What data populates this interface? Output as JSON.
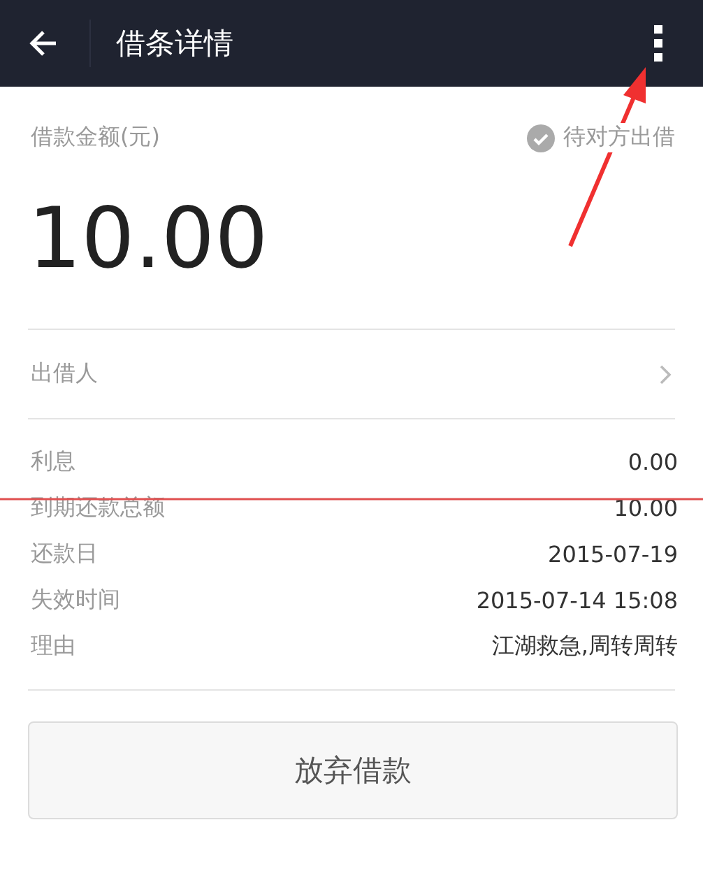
{
  "header": {
    "title": "借条详情"
  },
  "amount": {
    "label": "借款金额(元)",
    "value": "10.00",
    "status": "待对方出借"
  },
  "lender": {
    "label": "出借人"
  },
  "details": [
    {
      "label": "利息",
      "value": "0.00"
    },
    {
      "label": "到期还款总额",
      "value": "10.00"
    },
    {
      "label": "还款日",
      "value": "2015-07-19"
    },
    {
      "label": "失效时间",
      "value": "2015-07-14 15:08"
    },
    {
      "label": "理由",
      "value": "江湖救急,周转周转"
    }
  ],
  "button": {
    "label": "放弃借款"
  }
}
